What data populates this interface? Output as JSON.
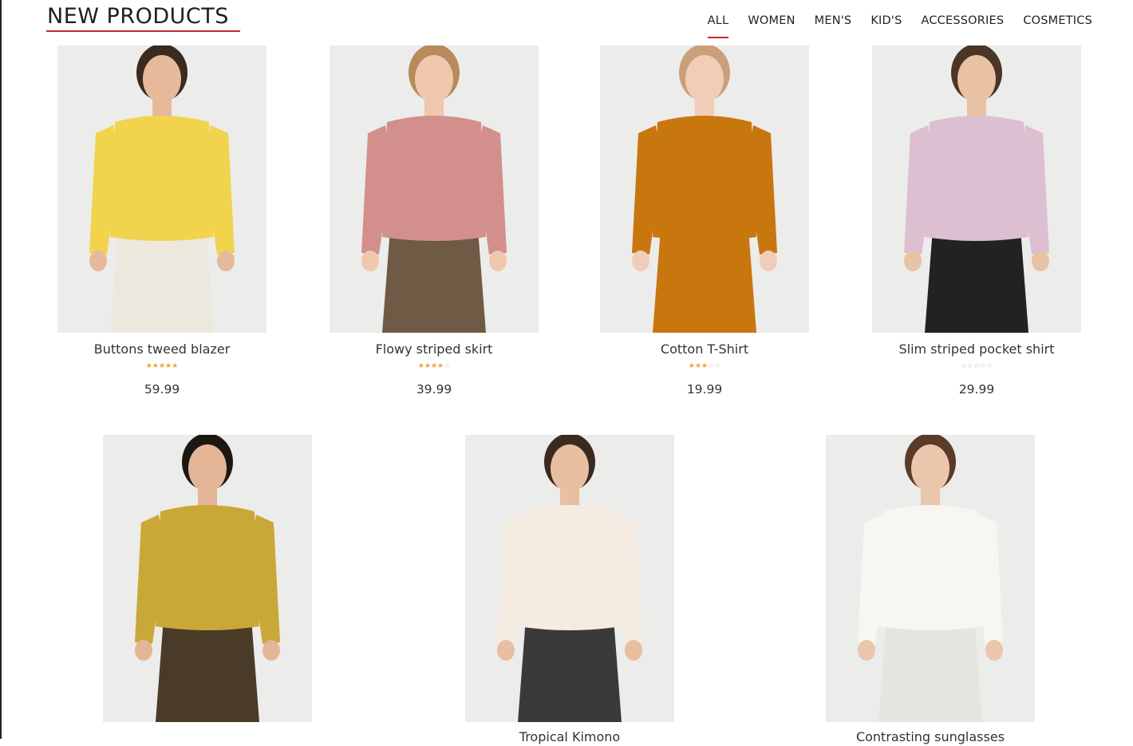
{
  "section": {
    "title": "NEW PRODUCTS"
  },
  "tabs": [
    {
      "label": "ALL",
      "active": true
    },
    {
      "label": "WOMEN",
      "active": false
    },
    {
      "label": "MEN'S",
      "active": false
    },
    {
      "label": "KID'S",
      "active": false
    },
    {
      "label": "ACCESSORIES",
      "active": false
    },
    {
      "label": "COSMETICS",
      "active": false
    }
  ],
  "colors": {
    "accent": "#c8262b",
    "star_filled": "#f0a232",
    "star_empty": "#c2c2c2",
    "photo_bg": "#ececeb"
  },
  "products": [
    {
      "name": "Buttons tweed blazer",
      "price": "59.99",
      "rating": 5,
      "max_rating": 5,
      "top_color": "#f1d34e",
      "bottom_color": "#ede8de",
      "skin": "#e6b99b",
      "hair": "#3b2a1f"
    },
    {
      "name": "Flowy striped skirt",
      "price": "39.99",
      "rating": 4,
      "max_rating": 5,
      "top_color": "#d28f8b",
      "bottom_color": "#6f5a45",
      "skin": "#efc7ad",
      "hair": "#b88a5c"
    },
    {
      "name": "Cotton T-Shirt",
      "price": "19.99",
      "rating": 3,
      "max_rating": 5,
      "top_color": "#c8770f",
      "bottom_color": "#c8770f",
      "skin": "#f0cdb6",
      "hair": "#c9a07a"
    },
    {
      "name": "Slim striped pocket shirt",
      "price": "29.99",
      "rating": 0,
      "max_rating": 5,
      "top_color": "#dcbfd0",
      "bottom_color": "#222222",
      "skin": "#e9c1a3",
      "hair": "#4a3527"
    },
    {
      "name": "",
      "price": "",
      "rating": 0,
      "max_rating": 5,
      "top_color": "#c9a838",
      "bottom_color": "#4a3a28",
      "skin": "#e4b596",
      "hair": "#1c1712"
    },
    {
      "name": "Tropical Kimono",
      "price": "",
      "rating": 0,
      "max_rating": 5,
      "top_color": "#f4ece1",
      "bottom_color": "#3a3a3c",
      "skin": "#e8bfa1",
      "hair": "#3b2a20"
    },
    {
      "name": "Contrasting sunglasses",
      "price": "",
      "rating": 0,
      "max_rating": 5,
      "top_color": "#f7f6f2",
      "bottom_color": "#e6e4df",
      "skin": "#eac6ad",
      "hair": "#5a3b28"
    }
  ]
}
